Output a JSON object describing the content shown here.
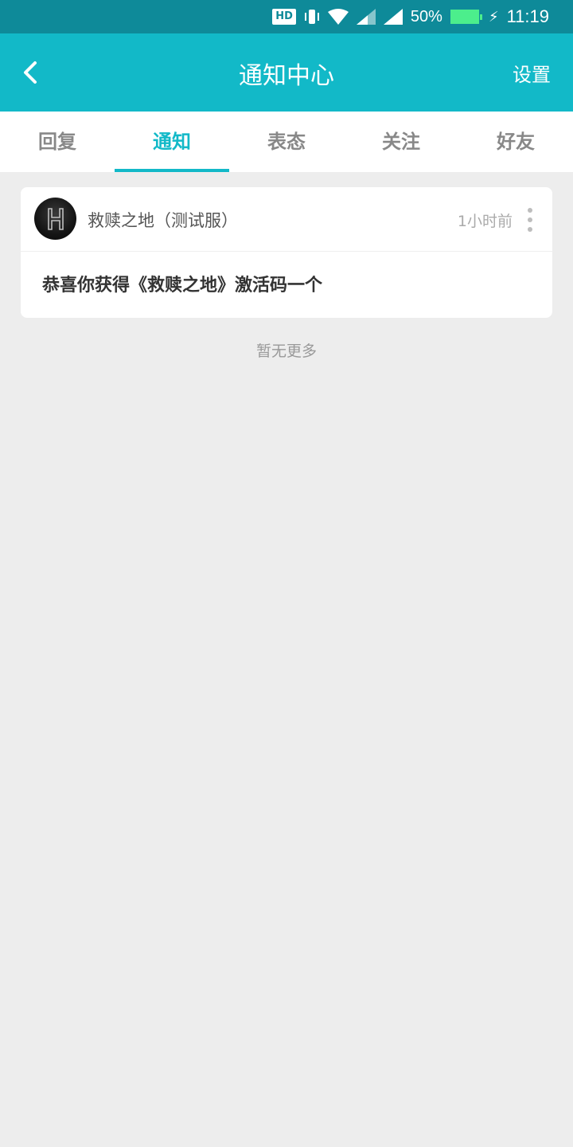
{
  "status_bar": {
    "hd": "HD",
    "battery_percent": "50%",
    "time": "11:19",
    "icons": [
      "hd-icon",
      "vibrate-icon",
      "wifi-icon",
      "signal-icon",
      "signal-icon",
      "battery-icon",
      "charging-icon"
    ],
    "battery_level": 0.5
  },
  "header": {
    "title": "通知中心",
    "settings_label": "设置",
    "back_icon": "chevron-left-icon"
  },
  "tabs": [
    {
      "label": "回复",
      "active": false
    },
    {
      "label": "通知",
      "active": true
    },
    {
      "label": "表态",
      "active": false
    },
    {
      "label": "关注",
      "active": false
    },
    {
      "label": "好友",
      "active": false
    }
  ],
  "notifications": [
    {
      "sender": "救赎之地（测试服）",
      "time": "1小时前",
      "message": "恭喜你获得《救赎之地》激活码一个",
      "avatar_icon": "game-logo-icon"
    }
  ],
  "footer": {
    "no_more_text": "暂无更多"
  },
  "colors": {
    "status_bar": "#0e8a99",
    "header": "#12b9c8",
    "accent": "#12b9c8",
    "background": "#ededed"
  }
}
